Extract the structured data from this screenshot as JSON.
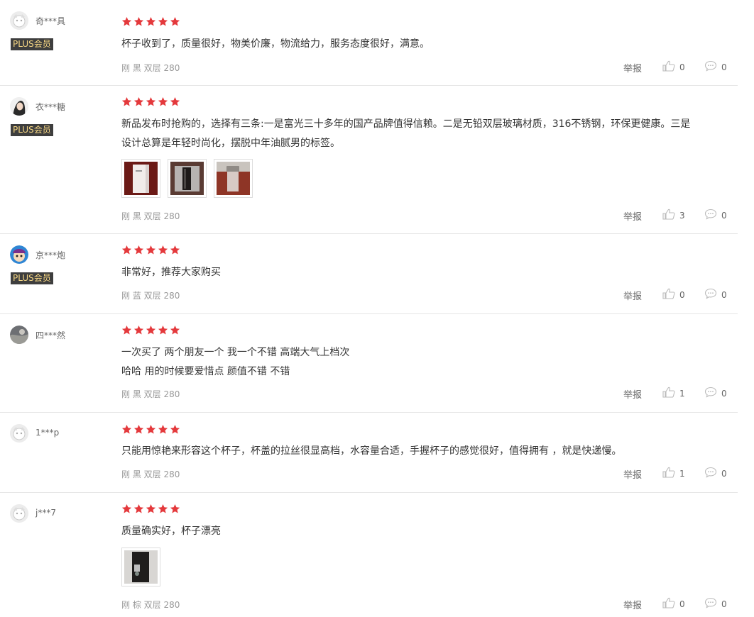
{
  "reviews": [
    {
      "user": "奇***具",
      "avatar": "default-avatar",
      "plus": "PLUS会员",
      "stars": 5,
      "lines": [
        "杯子收到了，质量很好，物美价廉，物流给力，服务态度很好，满意。"
      ],
      "images": [],
      "variant": "刚 黑 双层 280",
      "report": "举报",
      "likes": "0",
      "comments": "0"
    },
    {
      "user": "衣***糖",
      "avatar": "photo-avatar",
      "plus": "PLUS会员",
      "stars": 5,
      "lines": [
        "新品发布时抢购的，选择有三条:一是富光三十多年的国产品牌值得信赖。二是无铅双层玻璃材质，316不锈钢，环保更健康。三是",
        "设计总算是年轻时尚化，摆脱中年油腻男的标签。"
      ],
      "images": [
        "product-box-photo",
        "product-tube-photo",
        "glass-cup-photo"
      ],
      "variant": "刚 黑 双层 280",
      "report": "举报",
      "likes": "3",
      "comments": "0"
    },
    {
      "user": "京***炮",
      "avatar": "cartoon-avatar",
      "plus": "PLUS会员",
      "stars": 5,
      "lines": [
        "非常好，推荐大家购买"
      ],
      "images": [],
      "variant": "刚 蓝 双层 280",
      "report": "举报",
      "likes": "0",
      "comments": "0"
    },
    {
      "user": "四***然",
      "avatar": "photo-avatar",
      "plus": "",
      "stars": 5,
      "lines": [
        "一次买了 两个朋友一个 我一个不错 高端大气上档次",
        "哈哈 用的时候要爱惜点 颜值不错 不错"
      ],
      "images": [],
      "variant": "刚 黑 双层 280",
      "report": "举报",
      "likes": "1",
      "comments": "0"
    },
    {
      "user": "1***p",
      "avatar": "default-avatar",
      "plus": "",
      "stars": 5,
      "lines": [
        "只能用惊艳来形容这个杯子，杯盖的拉丝很显高档，水容量合适，手握杯子的感觉很好，值得拥有 ，就是快递慢。"
      ],
      "images": [],
      "variant": "刚 黑 双层 280",
      "report": "举报",
      "likes": "1",
      "comments": "0"
    },
    {
      "user": "j***7",
      "avatar": "default-avatar",
      "plus": "",
      "stars": 5,
      "lines": [
        "质量确实好，杯子漂亮"
      ],
      "images": [
        "cup-on-table-photo"
      ],
      "variant": "刚 棕 双层 280",
      "report": "举报",
      "likes": "0",
      "comments": "0"
    }
  ],
  "colors": {
    "star": "#e4393c",
    "plus_bg": "#3e3e3e",
    "plus_text": "#f6d784"
  }
}
